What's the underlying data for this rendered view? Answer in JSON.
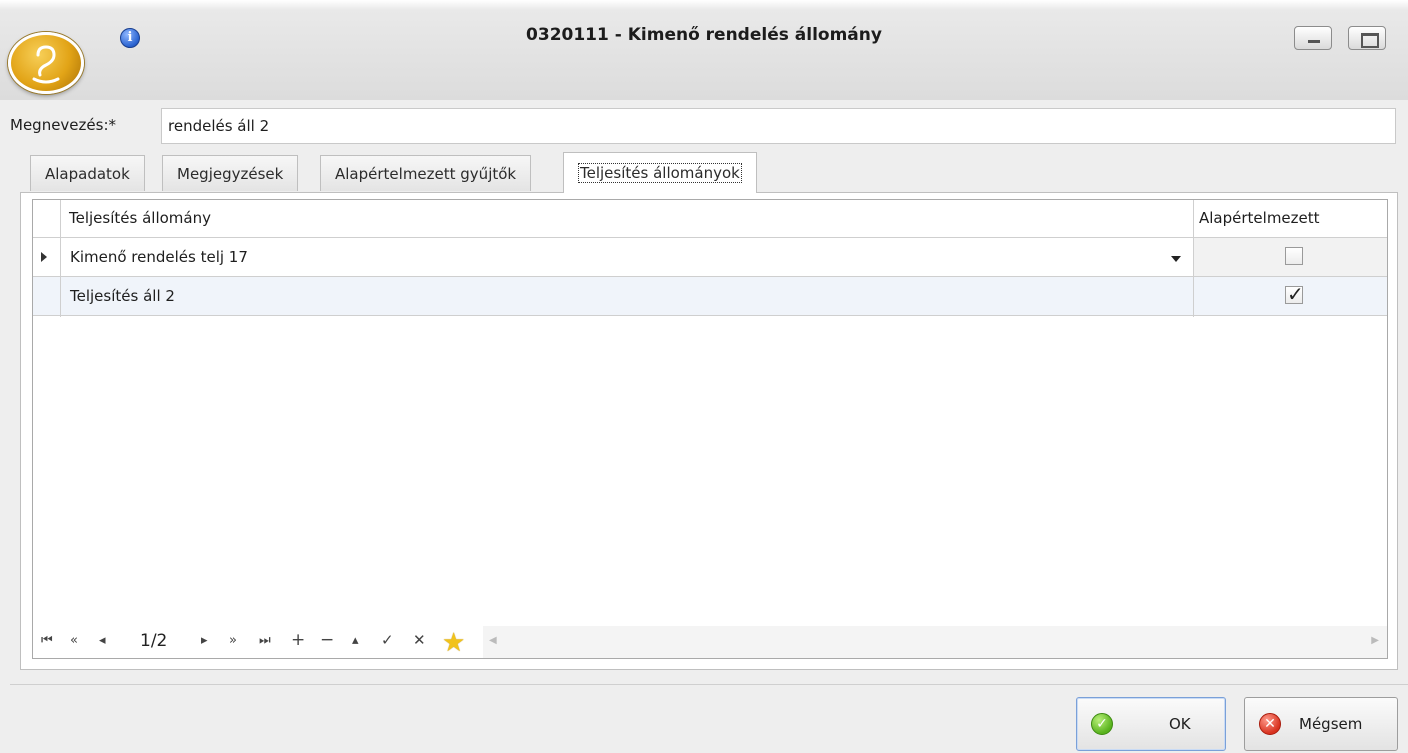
{
  "window": {
    "title": "0320111 - Kimenő rendelés állomány"
  },
  "form": {
    "name_label": "Megnevezés:*",
    "name_value": "rendelés áll 2"
  },
  "tabs": [
    {
      "label": "Alapadatok",
      "active": false
    },
    {
      "label": "Megjegyzések",
      "active": false
    },
    {
      "label": "Alapértelmezett gyűjtők",
      "active": false
    },
    {
      "label": "Teljesítés állományok",
      "active": true
    }
  ],
  "grid": {
    "columns": [
      "Teljesítés állomány",
      "Alapértelmezett"
    ],
    "rows": [
      {
        "name": "Kimenő rendelés telj 17",
        "default": false
      },
      {
        "name": "Teljesítés áll 2",
        "default": true
      }
    ]
  },
  "navigator": {
    "position": "1/2",
    "first": "⏮",
    "prev_page": "«",
    "prev": "◂",
    "next": "▸",
    "next_page": "»",
    "last": "⏭",
    "add": "+",
    "remove": "−",
    "edit": "▴",
    "confirm": "✓",
    "cancel": "✕",
    "bookmark": "★",
    "scroll_left": "◀",
    "scroll_right": "▶"
  },
  "buttons": {
    "ok": "OK",
    "cancel": "Mégsem"
  },
  "colors": {
    "accent": "#7aa0d8",
    "selected_row": "#f0f4fa",
    "logo": "#e2a417"
  }
}
